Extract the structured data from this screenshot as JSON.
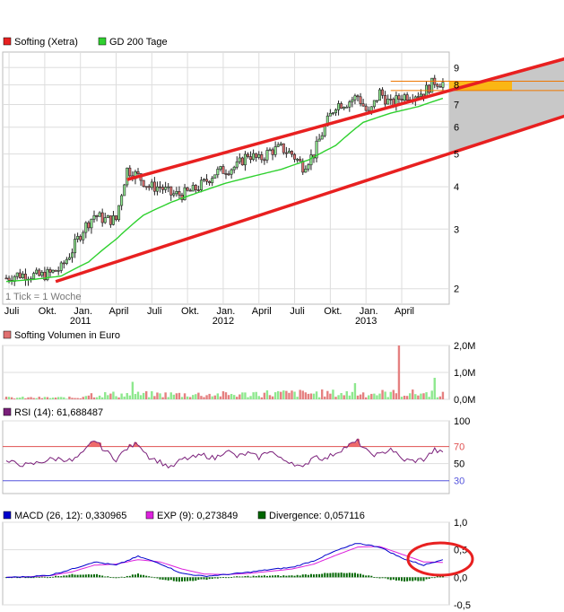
{
  "colors": {
    "price": "#222222",
    "gd200": "#2fd12f",
    "channel": "#e82020",
    "bullish": "#90e890",
    "bearish": "#e07070",
    "volume_up": "#8ee88e",
    "volume_down": "#e58080",
    "rsi": "#7a1f7a",
    "rsi_fill": "#ee6b6b",
    "rsi_70": "#e05050",
    "rsi_30": "#5555dd",
    "macd": "#0000cc",
    "exp": "#dd22dd",
    "divergence": "#006600",
    "projection": "#c8c8c8",
    "highlight": "#ffb400"
  },
  "chart_data": [
    {
      "type": "line",
      "panel": "price",
      "scale": "log",
      "ylim": [
        1.8,
        10
      ],
      "y_ticks": [
        "9",
        "8",
        "7",
        "6",
        "5",
        "4",
        "3",
        "2"
      ],
      "y_tick_values": [
        9,
        8,
        7,
        6,
        5,
        4,
        3,
        2
      ],
      "x_tick_labels": [
        "Juli",
        "Okt.",
        "Jan.",
        "April",
        "Juli",
        "Okt.",
        "Jan.",
        "April",
        "Juli",
        "Okt.",
        "Jan.",
        "April"
      ],
      "x_year_labels": [
        "2011",
        "2012",
        "2013"
      ],
      "legend": [
        {
          "name": "Softing (Xetra)",
          "color": "#e82020"
        },
        {
          "name": "GD 200 Tage",
          "color": "#2fd12f"
        }
      ],
      "annotation": "1 Tick = 1 Woche",
      "series": [
        {
          "name": "Softing (Xetra)",
          "kind": "candlestick",
          "week": [
            0,
            4,
            8,
            12,
            16,
            20,
            24,
            28,
            32,
            36,
            40,
            44,
            48,
            52,
            56,
            60,
            64,
            68,
            72,
            76,
            80,
            84,
            88,
            92,
            96,
            100,
            104,
            108,
            112,
            116,
            120,
            124,
            128,
            132,
            136,
            140,
            144,
            148,
            152,
            156,
            159
          ],
          "close": [
            2.15,
            2.2,
            2.2,
            2.18,
            2.22,
            2.3,
            2.6,
            3.0,
            3.3,
            3.2,
            3.2,
            4.5,
            4.3,
            4.0,
            4.0,
            3.8,
            3.8,
            3.9,
            4.1,
            4.4,
            4.5,
            4.6,
            5.0,
            4.8,
            5.1,
            5.2,
            5.0,
            4.6,
            5.0,
            6.0,
            7.0,
            7.1,
            7.4,
            6.5,
            7.6,
            7.0,
            7.4,
            7.5,
            7.6,
            8.2,
            8.1
          ]
        },
        {
          "name": "GD 200 Tage",
          "kind": "line",
          "week": [
            0,
            10,
            20,
            30,
            40,
            50,
            60,
            70,
            80,
            90,
            100,
            110,
            120,
            130,
            140,
            150,
            159
          ],
          "values": [
            2.1,
            2.13,
            2.18,
            2.4,
            2.8,
            3.3,
            3.6,
            3.85,
            4.1,
            4.3,
            4.5,
            4.8,
            5.3,
            6.2,
            6.6,
            6.9,
            7.3
          ]
        }
      ],
      "channel": {
        "upper": [
          {
            "week": 44,
            "value": 4.2
          },
          {
            "week": 254,
            "value": 12.4
          }
        ],
        "lower": [
          {
            "week": 18,
            "value": 2.1
          },
          {
            "week": 254,
            "value": 8.8
          }
        ],
        "horizontal_lines": [
          8.2,
          7.7
        ]
      }
    },
    {
      "type": "bar",
      "panel": "volume",
      "title": "Softing Volumen in Euro",
      "y_ticks": [
        "2,0M",
        "1,0M",
        "0,0M"
      ],
      "ylim": [
        0,
        2000000
      ],
      "notable_bars": [
        {
          "week": 46,
          "value": 650000,
          "direction": "up"
        },
        {
          "week": 127,
          "value": 600000,
          "direction": "up"
        },
        {
          "week": 143,
          "value": 2000000,
          "direction": "down"
        },
        {
          "week": 156,
          "value": 800000,
          "direction": "up"
        }
      ]
    },
    {
      "type": "line",
      "panel": "rsi",
      "title": "RSI (14): 61,688487",
      "series_name": "RSI (14)",
      "current_value": 61.688487,
      "ylim": [
        0,
        100
      ],
      "y_ticks": [
        "100",
        "70",
        "50",
        "30"
      ],
      "levels": [
        70,
        30
      ],
      "week": [
        0,
        8,
        16,
        20,
        24,
        28,
        32,
        36,
        40,
        44,
        48,
        52,
        56,
        60,
        64,
        68,
        72,
        76,
        80,
        84,
        88,
        92,
        96,
        100,
        104,
        108,
        112,
        116,
        120,
        124,
        128,
        132,
        136,
        140,
        144,
        148,
        152,
        156,
        159
      ],
      "values": [
        52,
        48,
        55,
        56,
        53,
        62,
        78,
        65,
        55,
        68,
        74,
        58,
        52,
        45,
        55,
        57,
        60,
        56,
        66,
        58,
        62,
        57,
        66,
        55,
        52,
        44,
        60,
        55,
        63,
        70,
        76,
        62,
        60,
        68,
        55,
        53,
        55,
        66,
        62
      ]
    },
    {
      "type": "line",
      "panel": "macd",
      "legend": [
        {
          "name": "MACD (26, 12): 0,330965",
          "color": "#0000cc"
        },
        {
          "name": "EXP (9): 0,273849",
          "color": "#dd22dd"
        },
        {
          "name": "Divergence: 0,057116",
          "color": "#006600"
        }
      ],
      "ylim": [
        -0.5,
        1.0
      ],
      "y_ticks": [
        "1,0",
        "0,5",
        "0,0",
        "-0,5"
      ],
      "week": [
        0,
        8,
        16,
        24,
        32,
        40,
        48,
        56,
        64,
        72,
        80,
        88,
        96,
        104,
        112,
        120,
        128,
        136,
        144,
        152,
        159
      ],
      "macd": [
        0.0,
        0.01,
        0.04,
        0.15,
        0.28,
        0.22,
        0.38,
        0.25,
        0.07,
        0.02,
        0.05,
        0.09,
        0.14,
        0.18,
        0.3,
        0.48,
        0.62,
        0.55,
        0.35,
        0.22,
        0.33
      ],
      "exp": [
        0.0,
        0.01,
        0.03,
        0.1,
        0.22,
        0.24,
        0.32,
        0.28,
        0.15,
        0.06,
        0.05,
        0.07,
        0.11,
        0.15,
        0.24,
        0.4,
        0.55,
        0.56,
        0.42,
        0.28,
        0.27
      ],
      "annotation_circle_week": 155
    }
  ]
}
